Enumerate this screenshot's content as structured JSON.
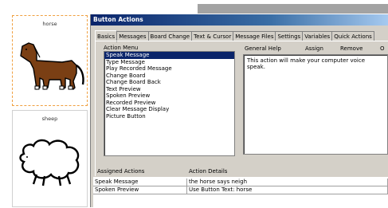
{
  "board": {
    "cells": [
      {
        "label": "horse",
        "image": "horse-picture"
      },
      {
        "label": "sheep",
        "image": "sheep-picture"
      }
    ]
  },
  "dialog": {
    "title": "Button Actions",
    "tabs": [
      "Basics",
      "Messages",
      "Board Change",
      "Text & Cursor",
      "Message Files",
      "Settings",
      "Variables",
      "Quick Actions"
    ],
    "active_tab": "Basics",
    "action_menu_label": "Action Menu",
    "action_menu_items": [
      "Speak Message",
      "Type Message",
      "Play Recorded Message",
      "Change Board",
      "Change Board Back",
      "Text Preview",
      "Spoken Preview",
      "Recorded Preview",
      "Clear Message Display",
      "Picture Button"
    ],
    "selected_action": "Speak Message",
    "general_help_label": "General Help",
    "assign_label": "Assign",
    "remove_label": "Remove",
    "extra_label": "O",
    "help_text": "This action will make your computer voice speak.",
    "assigned": {
      "col_action": "Assigned Actions",
      "col_details": "Action Details",
      "rows": [
        {
          "action": "Speak Message",
          "details": "the horse says neigh"
        },
        {
          "action": "Spoken Preview",
          "details": "Use Button Text: horse"
        }
      ]
    }
  }
}
